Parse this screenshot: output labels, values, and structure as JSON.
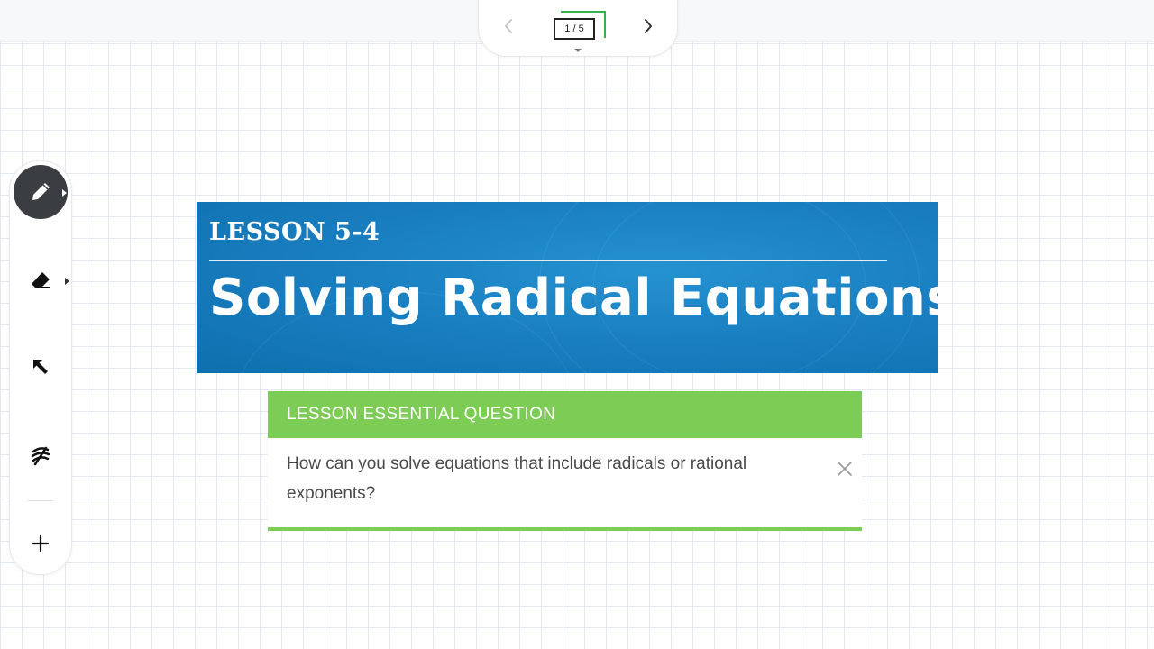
{
  "pager": {
    "current_page": "1 / 5",
    "prev_icon": "chevron-left-icon",
    "next_icon": "chevron-right-icon"
  },
  "toolbar": {
    "tools": [
      {
        "name": "pen",
        "icon": "pen-icon",
        "active": true
      },
      {
        "name": "eraser",
        "icon": "eraser-icon",
        "active": false
      },
      {
        "name": "select",
        "icon": "arrow-up-left-icon",
        "active": false
      },
      {
        "name": "clear",
        "icon": "clear-strokes-icon",
        "active": false
      },
      {
        "name": "add",
        "icon": "plus-icon",
        "active": false
      }
    ]
  },
  "slide": {
    "lesson_number": "LESSON 5-4",
    "title": "Solving Radical Equations",
    "essential_question": {
      "header": "LESSON ESSENTIAL QUESTION",
      "text": "How can you solve equations that include radicals or rational exponents?"
    }
  },
  "colors": {
    "banner_blue": "#1a80c2",
    "question_green": "#7ccc55",
    "active_tool": "#3a3d42",
    "page_bracket": "#2fb34a"
  }
}
